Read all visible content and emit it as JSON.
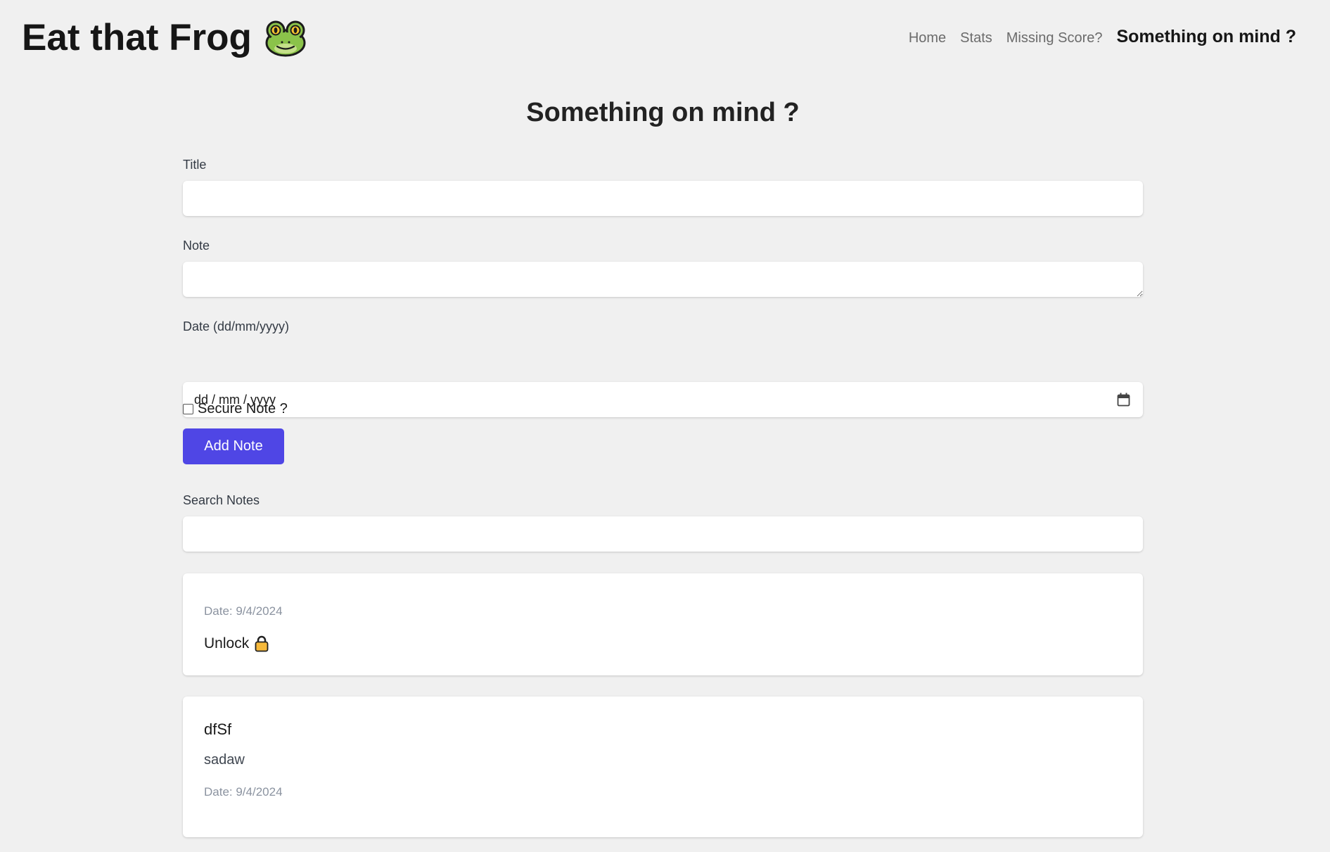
{
  "header": {
    "app_title": "Eat that Frog",
    "nav": {
      "home": "Home",
      "stats": "Stats",
      "missing_score": "Missing Score?",
      "something_on_mind": "Something on mind ?"
    }
  },
  "page": {
    "title": "Something on mind ?"
  },
  "form": {
    "title_label": "Title",
    "title_value": "",
    "note_label": "Note",
    "note_value": "",
    "date_label": "Date (dd/mm/yyyy)",
    "date_placeholder": "dd / mm / yyyy",
    "secure_label": "Secure Note ?",
    "secure_checked": false,
    "submit_label": "Add Note"
  },
  "search": {
    "label": "Search Notes",
    "value": ""
  },
  "notes": [
    {
      "secure": true,
      "date": "Date: 9/4/2024",
      "unlock_label": "Unlock"
    },
    {
      "secure": false,
      "title": "dfSf",
      "body": "sadaw",
      "date": "Date: 9/4/2024"
    }
  ],
  "icons": {
    "brand": "frog-icon",
    "date": "calendar-icon",
    "secure": "lock-icon"
  },
  "colors": {
    "background": "#f0f0f0",
    "accent": "#4f46e5",
    "muted_text": "#8b93a0"
  }
}
